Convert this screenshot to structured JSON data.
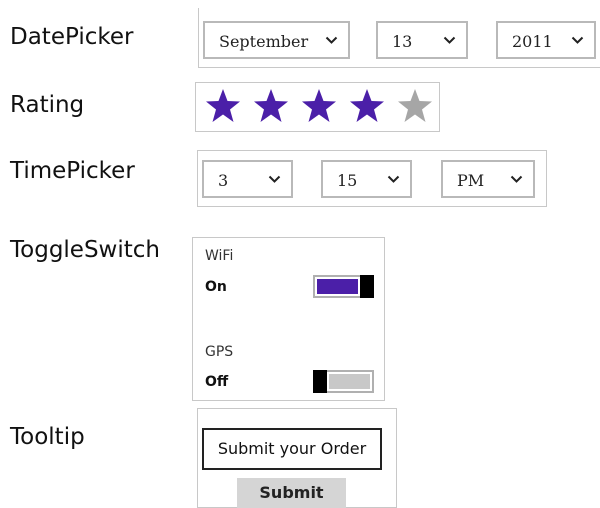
{
  "labels": {
    "datepicker": "DatePicker",
    "rating": "Rating",
    "timepicker": "TimePicker",
    "toggleswitch": "ToggleSwitch",
    "tooltip": "Tooltip"
  },
  "datepicker": {
    "month": "September",
    "day": "13",
    "year": "2011",
    "chevron_icon": "chevron-down"
  },
  "rating": {
    "value": 4,
    "max": 5,
    "filled_color": "#4b1fa8",
    "empty_color": "#a6a6a6",
    "icon": "star"
  },
  "timepicker": {
    "hour": "3",
    "minute": "15",
    "period": "PM",
    "chevron_icon": "chevron-down"
  },
  "toggles": [
    {
      "header": "WiFi",
      "state": "On",
      "on": true,
      "on_color": "#4b1fa8"
    },
    {
      "header": "GPS",
      "state": "Off",
      "on": false,
      "off_color": "#c8c8c8"
    }
  ],
  "tooltip": {
    "text": "Submit your Order",
    "button_label": "Submit"
  }
}
